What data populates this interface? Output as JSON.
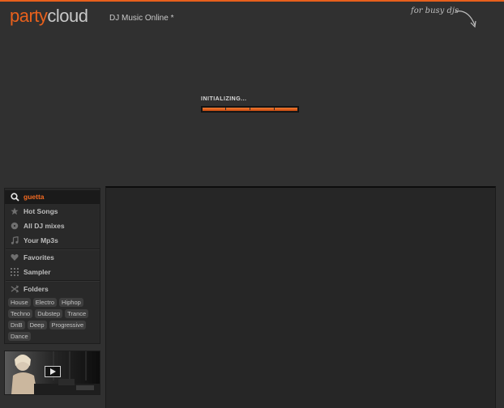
{
  "header": {
    "logo_part1": "party",
    "logo_part2": "cloud",
    "tagline": "DJ Music Online *",
    "busy_note": "for busy djs"
  },
  "loader": {
    "label": "INITIALIZING...",
    "progress_fraction": 1.0
  },
  "sidebar": {
    "search_value": "guetta",
    "items": [
      {
        "label": "Hot Songs",
        "icon": "star-icon"
      },
      {
        "label": "All DJ mixes",
        "icon": "vinyl-icon"
      },
      {
        "label": "Your Mp3s",
        "icon": "music-note-icon"
      },
      {
        "label": "Favorites",
        "icon": "heart-icon"
      },
      {
        "label": "Sampler",
        "icon": "grid-icon"
      },
      {
        "label": "Folders",
        "icon": "shuffle-icon"
      }
    ],
    "genre_tags": [
      "House",
      "Electro",
      "Hiphop",
      "Techno",
      "Dubstep",
      "Trance",
      "DnB",
      "Deep",
      "Progressive",
      "Dance"
    ]
  },
  "video_thumb": {
    "play_icon": "play-icon"
  },
  "colors": {
    "accent": "#e8601c",
    "background": "#303030",
    "panel": "#262626"
  }
}
